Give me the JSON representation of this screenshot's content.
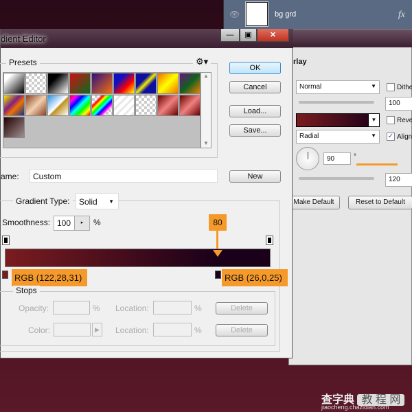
{
  "layers_panel": {
    "layer_name": "bg grd",
    "fx_label": "fx"
  },
  "layer_style": {
    "section": "rlay",
    "blend_mode": "Normal",
    "dither_label": "Dithe",
    "opacity": "100",
    "reverse_label": "Rever",
    "style": "Radial",
    "align_label": "Align",
    "align_checked": true,
    "angle": "90",
    "angle_unit": "°",
    "scale": "120",
    "make_default": "Make Default",
    "reset_default": "Reset to Default",
    "gradient_colors": [
      "#7a1c1f",
      "#1a0019"
    ]
  },
  "gradient_editor": {
    "title": "dient Editor",
    "presets_label": "Presets",
    "buttons": {
      "ok": "OK",
      "cancel": "Cancel",
      "load": "Load...",
      "save": "Save...",
      "new": "New"
    },
    "name_label": "ame:",
    "name_value": "Custom",
    "gradient_type_label": "Gradient Type:",
    "gradient_type": "Solid",
    "smoothness_label": "Smoothness:",
    "smoothness": "100",
    "percent": "%",
    "stops": {
      "label": "Stops",
      "opacity_label": "Opacity:",
      "color_label": "Color:",
      "location_label": "Location:",
      "delete_label": "Delete"
    },
    "color_stops": [
      {
        "location": 0,
        "color": "#7a1c1f",
        "label": "RGB (122,28,31)"
      },
      {
        "location": 80,
        "color": "#1a0019",
        "label": "RGB (26,0,25)"
      }
    ],
    "annotation_location": "80"
  },
  "watermark": {
    "brand": "查字典 教程网",
    "url": "jiaocheng.chazidian.com"
  },
  "colors": {
    "annotation": "#f59a2a",
    "background": "#3a0d1c"
  }
}
